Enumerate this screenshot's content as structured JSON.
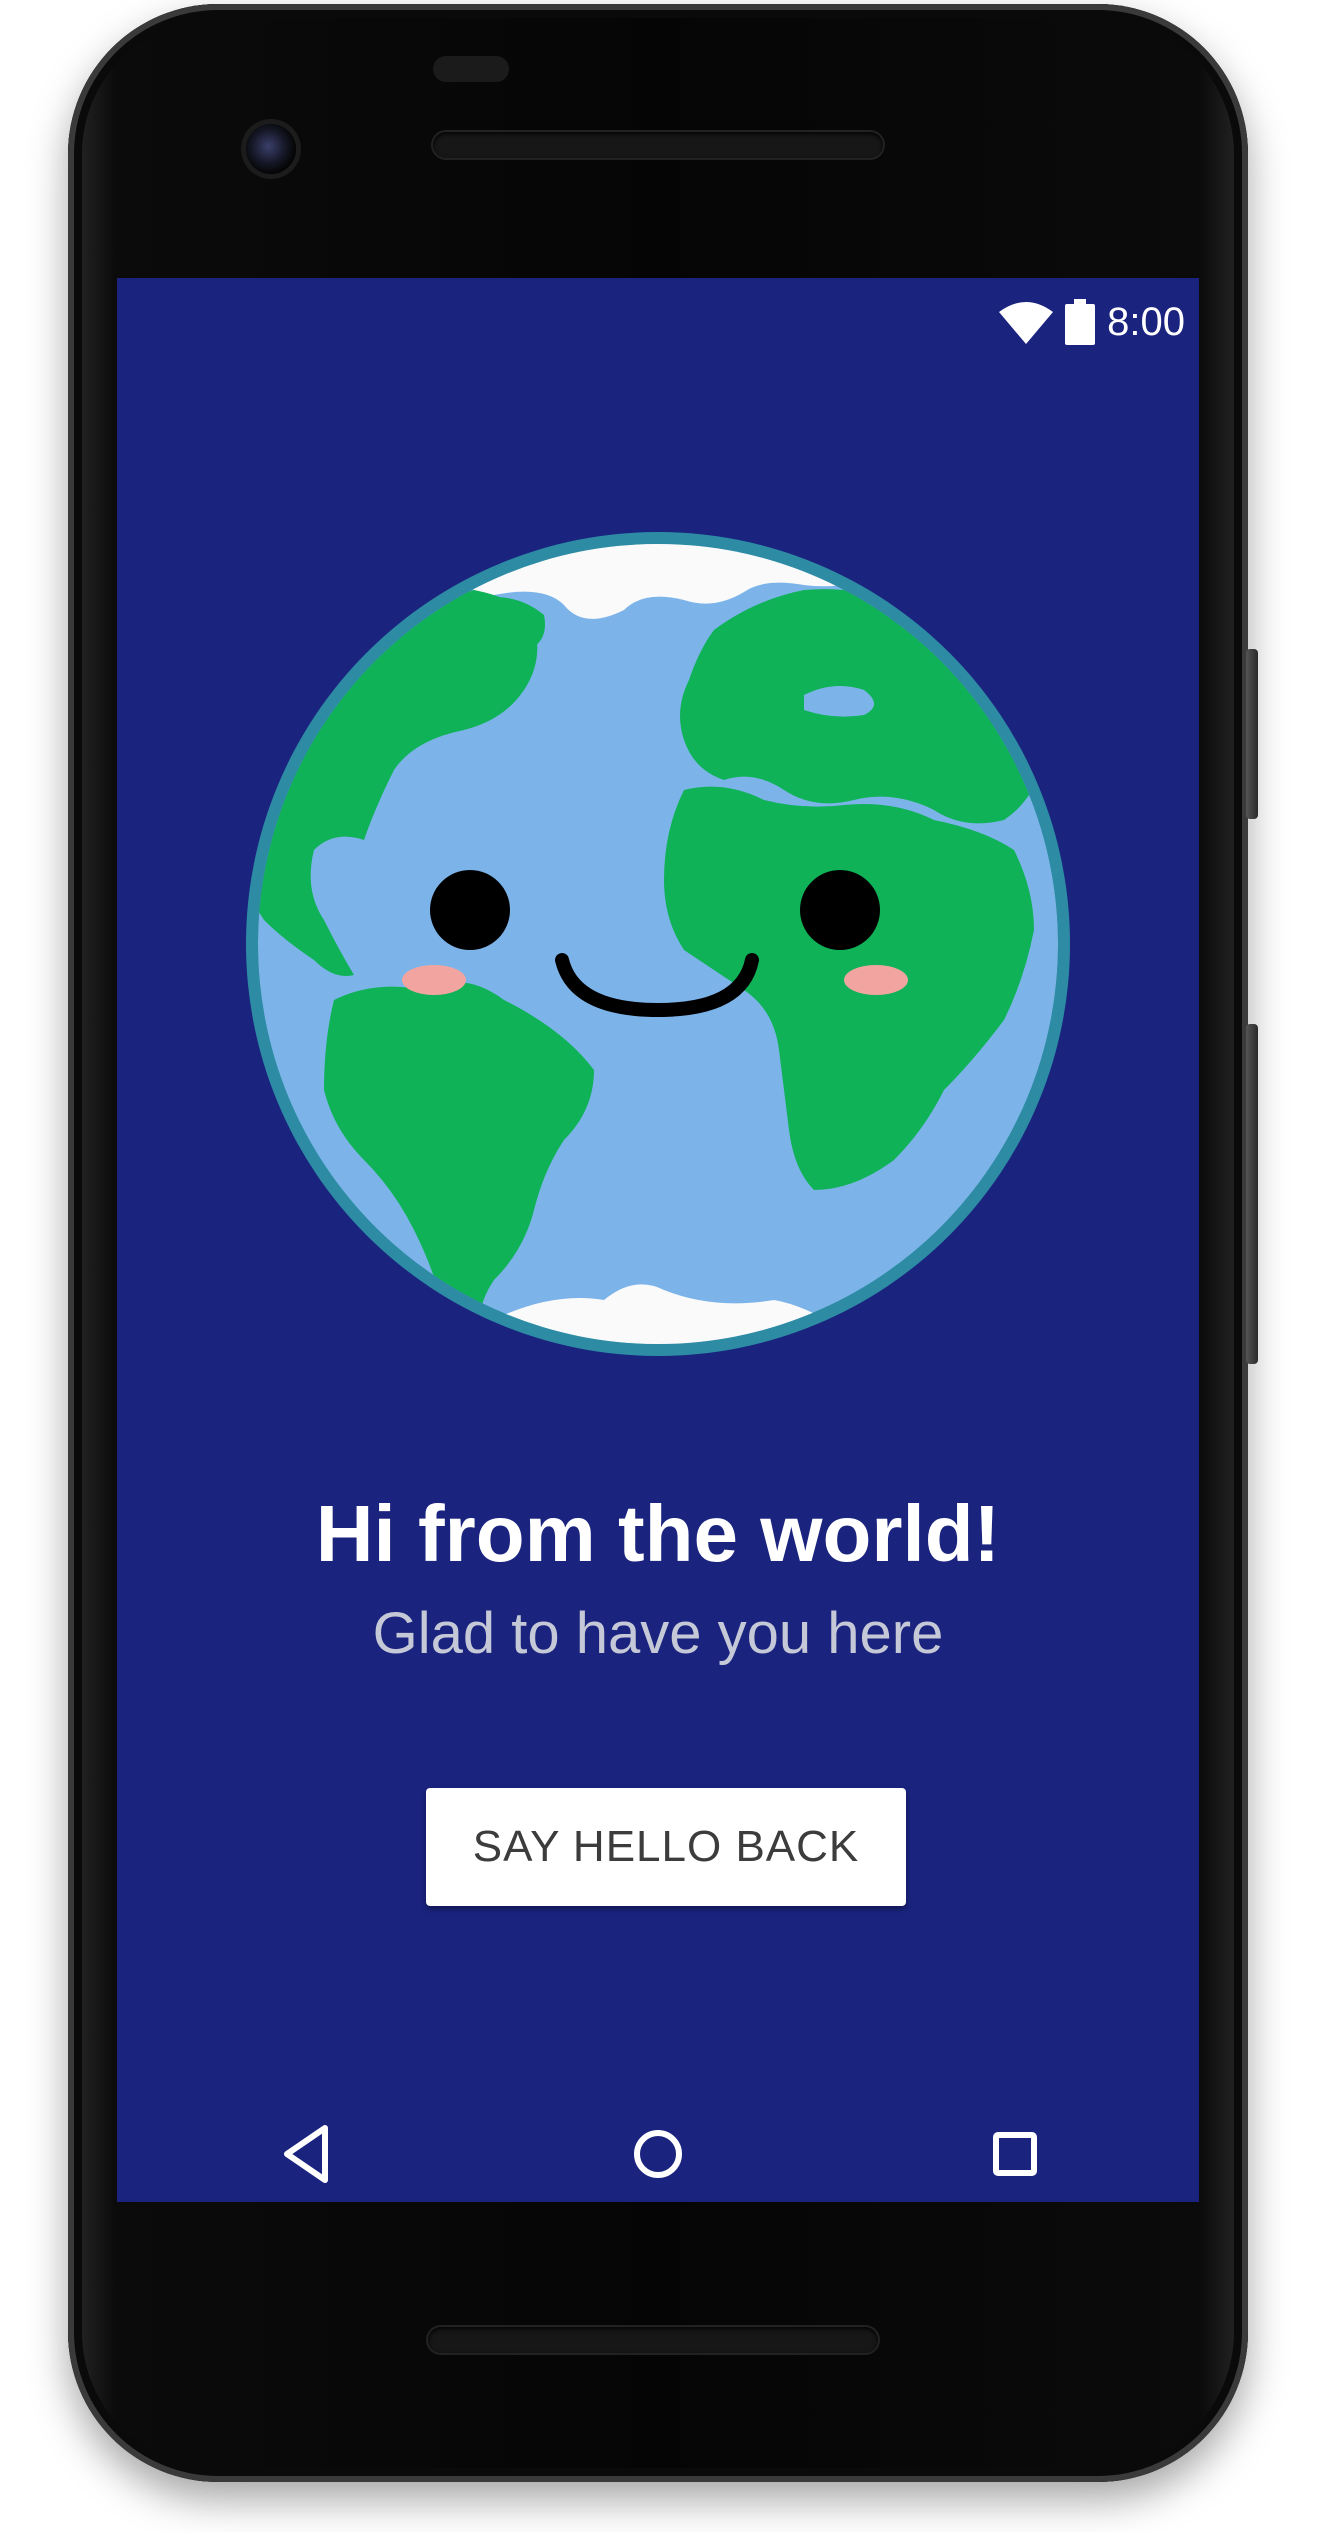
{
  "device": {
    "name": "android-phone"
  },
  "status_bar": {
    "time": "8:00",
    "icons": [
      "wifi-icon",
      "battery-icon"
    ]
  },
  "main": {
    "illustration": "smiling-earth-globe",
    "title": "Hi from the world!",
    "subtitle": "Glad to have you here",
    "button_label": "SAY HELLO BACK"
  },
  "nav_bar": {
    "items": [
      "back-icon",
      "home-icon",
      "recents-icon"
    ]
  },
  "colors": {
    "background": "#1a237e",
    "ocean": "#7cb4ea",
    "land": "#10b258",
    "globe_rim": "#2d8ba4",
    "ice": "#fafafa",
    "blush": "#f2a5a0",
    "button_bg": "#ffffff",
    "title_text": "#ffffff",
    "subtitle_text": "#c5c8d6"
  }
}
